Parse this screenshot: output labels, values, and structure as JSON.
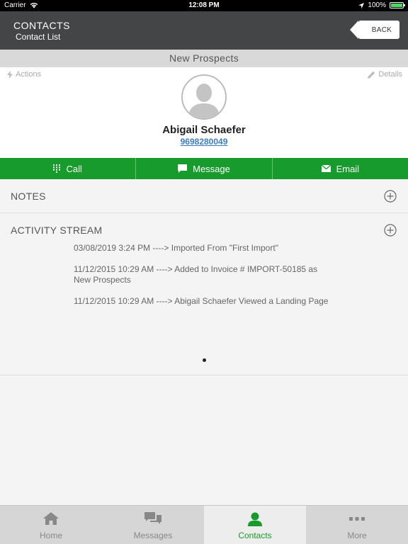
{
  "status_bar": {
    "carrier": "Carrier",
    "time": "12:08 PM",
    "battery": "100%",
    "battery_level": 1.0
  },
  "header": {
    "title": "CONTACTS",
    "subtitle": "Contact List",
    "back_label": "BACK"
  },
  "group": {
    "title": "New Prospects"
  },
  "profile": {
    "actions_label": "Actions",
    "details_label": "Details",
    "name": "Abigail Schaefer",
    "phone": "9698280049"
  },
  "action_bar": {
    "call_label": "Call",
    "message_label": "Message",
    "email_label": "Email",
    "color": "#169b2c"
  },
  "notes": {
    "title": "NOTES"
  },
  "activity": {
    "title": "ACTIVITY STREAM",
    "items": [
      "03/08/2019 3:24 PM ----> Imported From \"First Import\"",
      "11/12/2015 10:29 AM ----> Added to Invoice # IMPORT-50185 as New Prospects",
      "11/12/2015 10:29 AM ----> Abigail Schaefer Viewed a Landing Page"
    ]
  },
  "tabbar": {
    "tabs": [
      {
        "label": "Home",
        "icon": "home-icon"
      },
      {
        "label": "Messages",
        "icon": "messages-icon"
      },
      {
        "label": "Contacts",
        "icon": "contacts-icon",
        "active": true
      },
      {
        "label": "More",
        "icon": "more-icon"
      }
    ],
    "active_color": "#169b2c"
  }
}
